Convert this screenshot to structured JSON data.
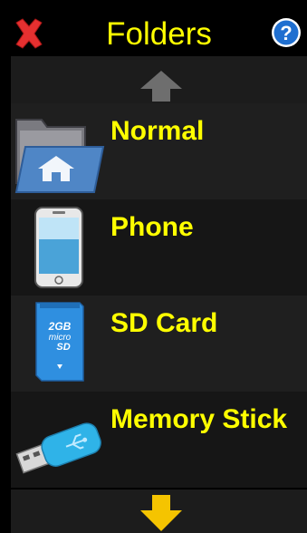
{
  "header": {
    "title": "Folders",
    "close_icon": "close-icon",
    "help_icon": "help-icon"
  },
  "scroll": {
    "up_icon": "arrow-up-icon",
    "down_icon": "arrow-down-icon"
  },
  "folders": [
    {
      "label": "Normal",
      "icon": "home-folder-icon"
    },
    {
      "label": "Phone",
      "icon": "phone-icon"
    },
    {
      "label": "SD Card",
      "icon": "sd-card-icon"
    },
    {
      "label": "Memory Stick",
      "icon": "usb-stick-icon"
    }
  ],
  "sd_card_label": {
    "capacity": "2GB",
    "brand_top": "micro",
    "brand_bottom": "SD"
  },
  "colors": {
    "accent_text": "#ffff00",
    "close_red": "#e53030",
    "help_blue": "#1f6fd0",
    "arrow_up": "#6e6e6e",
    "arrow_down": "#f5c400"
  }
}
